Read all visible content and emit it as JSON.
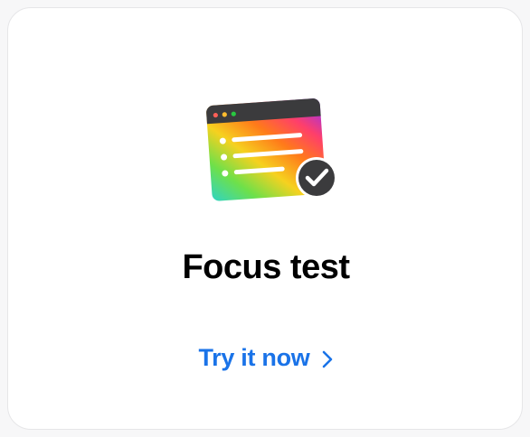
{
  "card": {
    "title": "Focus test",
    "cta_label": "Try it now",
    "icon": "focus-test-app-icon",
    "cta_icon": "chevron-right-icon",
    "accent_color": "#1a73e8",
    "title_color": "#000000"
  }
}
